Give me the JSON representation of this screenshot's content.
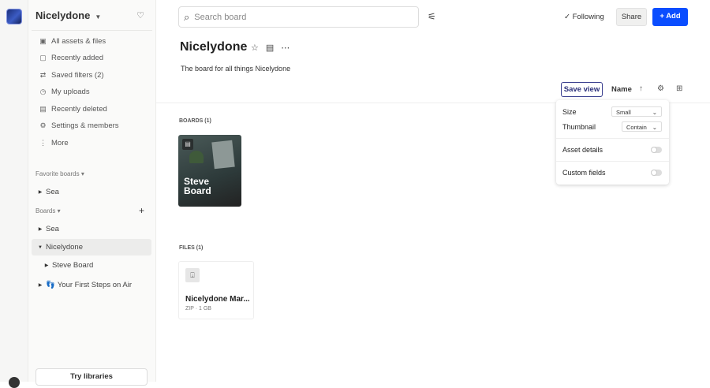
{
  "sidebar": {
    "workspace": "Nicelydone",
    "nav": [
      {
        "label": "All assets & files",
        "icon": "assets-icon"
      },
      {
        "label": "Recently added",
        "icon": "recent-icon"
      },
      {
        "label": "Saved filters (2)",
        "icon": "filters-icon"
      },
      {
        "label": "My uploads",
        "icon": "clock-icon"
      },
      {
        "label": "Recently deleted",
        "icon": "trash-icon"
      },
      {
        "label": "Settings & members",
        "icon": "gear-icon"
      },
      {
        "label": "More",
        "icon": "more-icon"
      }
    ],
    "favorites_label": "Favorite boards",
    "favorites": [
      "Sea"
    ],
    "boards_label": "Boards",
    "boards": [
      "Sea",
      "Nicelydone",
      "Steve Board",
      "Your First Steps on Air"
    ],
    "try_libraries": "Try libraries"
  },
  "header": {
    "search_placeholder": "Search board",
    "following": "Following",
    "share": "Share",
    "add": "Add"
  },
  "board": {
    "title": "Nicelydone",
    "description": "The board for all things Nicelydone"
  },
  "toolbar": {
    "save_view": "Save view",
    "sort": "Name"
  },
  "view_popover": {
    "size_label": "Size",
    "size_value": "Small",
    "thumbnail_label": "Thumbnail",
    "thumbnail_value": "Contain",
    "asset_details": "Asset details",
    "custom_fields": "Custom fields",
    "asset_details_on": false,
    "custom_fields_on": false
  },
  "boards_section": {
    "label": "BOARDS (1)",
    "items": [
      {
        "name": "Steve Board"
      }
    ]
  },
  "files_section": {
    "label": "FILES (1)",
    "items": [
      {
        "name": "Nicelydone Mar...",
        "meta": "ZIP · 1 GB"
      }
    ]
  }
}
